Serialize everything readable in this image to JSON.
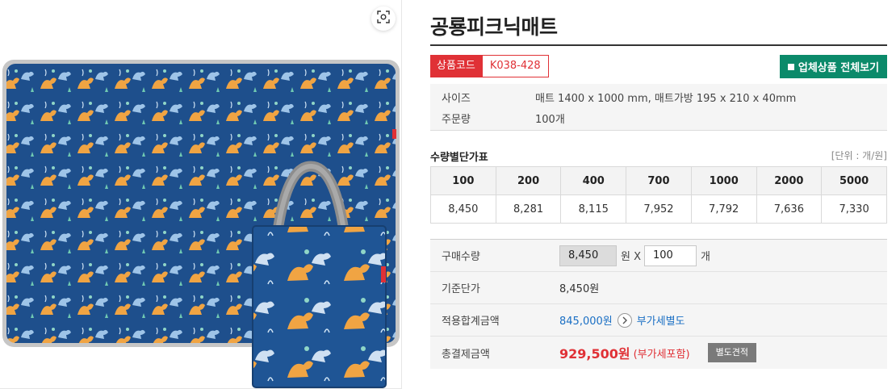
{
  "product": {
    "title": "공룡피크닉매트",
    "code_label": "상품코드",
    "code_value": "K038-428",
    "vendor_button": "업체상품 전체보기"
  },
  "specs": [
    {
      "label": "사이즈",
      "value": "매트 1400 x 1000 mm, 매트가방 195 x 210 x 40mm"
    },
    {
      "label": "주문량",
      "value": "100개"
    }
  ],
  "qty_table": {
    "title": "수량별단가표",
    "unit_note": "[단위 : 개/원]",
    "quantities": [
      "100",
      "200",
      "400",
      "700",
      "1000",
      "2000",
      "5000"
    ],
    "prices": [
      "8,450",
      "8,281",
      "8,115",
      "7,952",
      "7,792",
      "7,636",
      "7,330"
    ]
  },
  "order": {
    "purchase_qty_label": "구매수량",
    "unit_price_value": "8,450",
    "won_x": "원 X",
    "qty_value": "100",
    "qty_unit": "개",
    "base_price_label": "기준단가",
    "base_price_value": "8,450원",
    "applied_total_label": "적용합계금액",
    "applied_total_value": "845,000원",
    "vat_separate": "부가세별도",
    "grand_total_label": "총결제금액",
    "grand_total_value": "929,500원",
    "vat_included": "(부가세포함)",
    "quote_button": "별도견적"
  },
  "colors": {
    "accent_red": "#e03136",
    "vendor_green": "#0b8a6a",
    "link_blue": "#1a6fc4",
    "mat_blue": "#1e4f8c"
  },
  "icons": {
    "zoom": "zoom-scan-icon",
    "vendor": "square-icon",
    "arrow": "chevron-right-icon"
  }
}
